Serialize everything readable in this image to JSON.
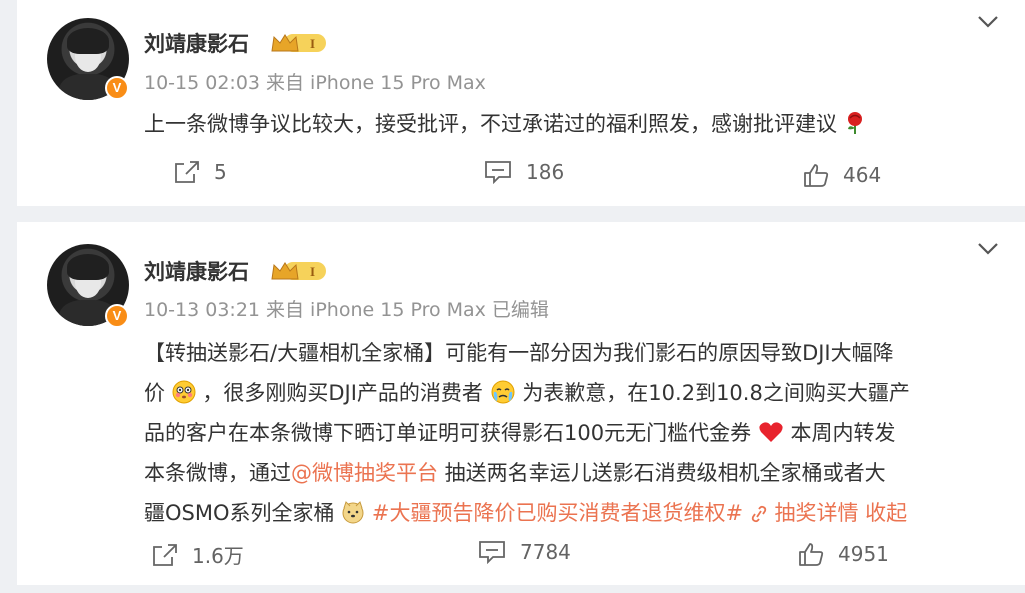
{
  "posts": [
    {
      "author": "刘靖康影石",
      "level_badge": "I",
      "verified": "V",
      "time": "10-15 02:03",
      "source": "来自 iPhone 15 Pro Max",
      "edited": "",
      "text": "上一条微博争议比较大，接受批评，不过承诺过的福利照发，感谢批评建议",
      "repost_count": "5",
      "comment_count": "186",
      "like_count": "464"
    },
    {
      "author": "刘靖康影石",
      "level_badge": "I",
      "verified": "V",
      "time": "10-13 03:21",
      "source": "来自 iPhone 15 Pro Max",
      "edited": "已编辑",
      "lines": {
        "l1": "【转抽送影石/大疆相机全家桶】可能有一部分因为我们影石的原因导致DJI大幅降",
        "l2a": "价",
        "l2b": "，很多刚购买DJI产品的消费者",
        "l2c": " 为表歉意，在10.2到10.8之间购买大疆产",
        "l3a": "品的客户在本条微博下晒订单证明可获得影石100元无门槛代金券",
        "l3b": " 本周内转发",
        "l4a": "本条微博，通过",
        "l4_mention": "@微博抽奖平台",
        "l4b": " 抽送两名幸运儿送影石消费级相机全家桶或者大",
        "l5a": "疆OSMO系列全家桶",
        "l5_tag": "#大疆预告降价已购买消费者退货维权#",
        "l5_lottery": " 抽奖详情",
        "l5_collapse": " 收起"
      },
      "repost_count": "1.6万",
      "comment_count": "7784",
      "like_count": "4951"
    }
  ],
  "icons": {
    "repost": "share-icon",
    "comment": "comment-icon",
    "like": "thumbs-up-icon",
    "more": "chevron-down-icon"
  },
  "colors": {
    "link": "#eb7350",
    "verified": "#f98d16",
    "meta": "#939393"
  }
}
